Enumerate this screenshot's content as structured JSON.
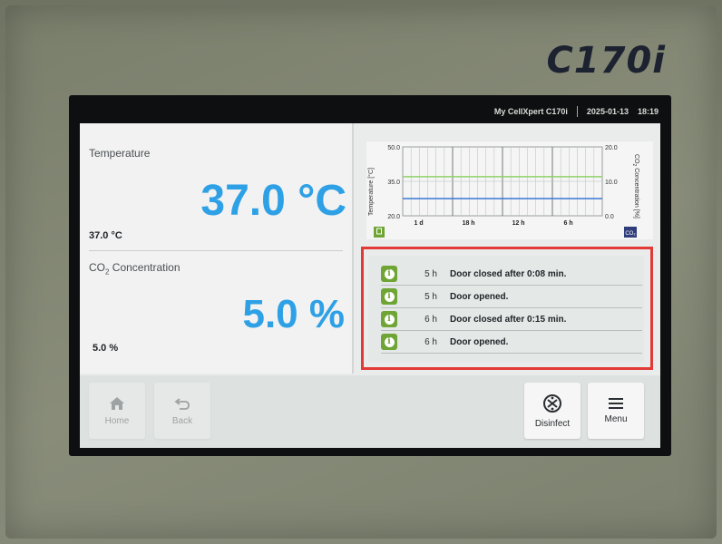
{
  "device": {
    "brand": "C170i"
  },
  "statusbar": {
    "device_name": "My CellXpert C170i",
    "date": "2025-01-13",
    "time": "18:19"
  },
  "temperature": {
    "label": "Temperature",
    "value": "37.0 °C",
    "setpoint": "37.0 °C"
  },
  "co2": {
    "label_prefix": "CO",
    "label_sub": "2",
    "label_suffix": " Concentration",
    "value": "5.0 %",
    "setpoint": "5.0 %"
  },
  "chart_data": {
    "type": "line",
    "x_ticks": [
      "1 d",
      "18 h",
      "12 h",
      "6 h"
    ],
    "left_axis": {
      "label": "Temperature [°C]",
      "ticks": [
        "50.0",
        "35.0",
        "20.0"
      ],
      "ylim": [
        20,
        50
      ]
    },
    "right_axis": {
      "label_prefix": "CO",
      "label_sub": "2",
      "label_suffix": " Concentration [%]",
      "ticks": [
        "20.0",
        "10.0",
        "0.0"
      ],
      "ylim": [
        0,
        20
      ]
    },
    "series": [
      {
        "axis": "left",
        "color": "#8fd06a",
        "values": [
          37,
          37,
          37,
          37,
          37
        ]
      },
      {
        "axis": "right",
        "color": "#3a77d8",
        "values": [
          5,
          5,
          5,
          5,
          5
        ]
      }
    ],
    "colors": {
      "temp_badge": "#6ea534",
      "co2_badge": "#2f3e7a"
    }
  },
  "events": [
    {
      "age": "5 h",
      "text": "Door closed after 0:08 min."
    },
    {
      "age": "5 h",
      "text": "Door opened."
    },
    {
      "age": "6 h",
      "text": "Door closed after 0:15 min."
    },
    {
      "age": "6 h",
      "text": "Door opened."
    }
  ],
  "nav": {
    "home": "Home",
    "back": "Back",
    "disinfect": "Disinfect",
    "menu": "Menu"
  },
  "icons": {
    "home": "home-icon",
    "back": "back-arrow-icon",
    "disinfect": "disinfect-icon",
    "menu": "menu-icon",
    "event": "info-icon"
  }
}
